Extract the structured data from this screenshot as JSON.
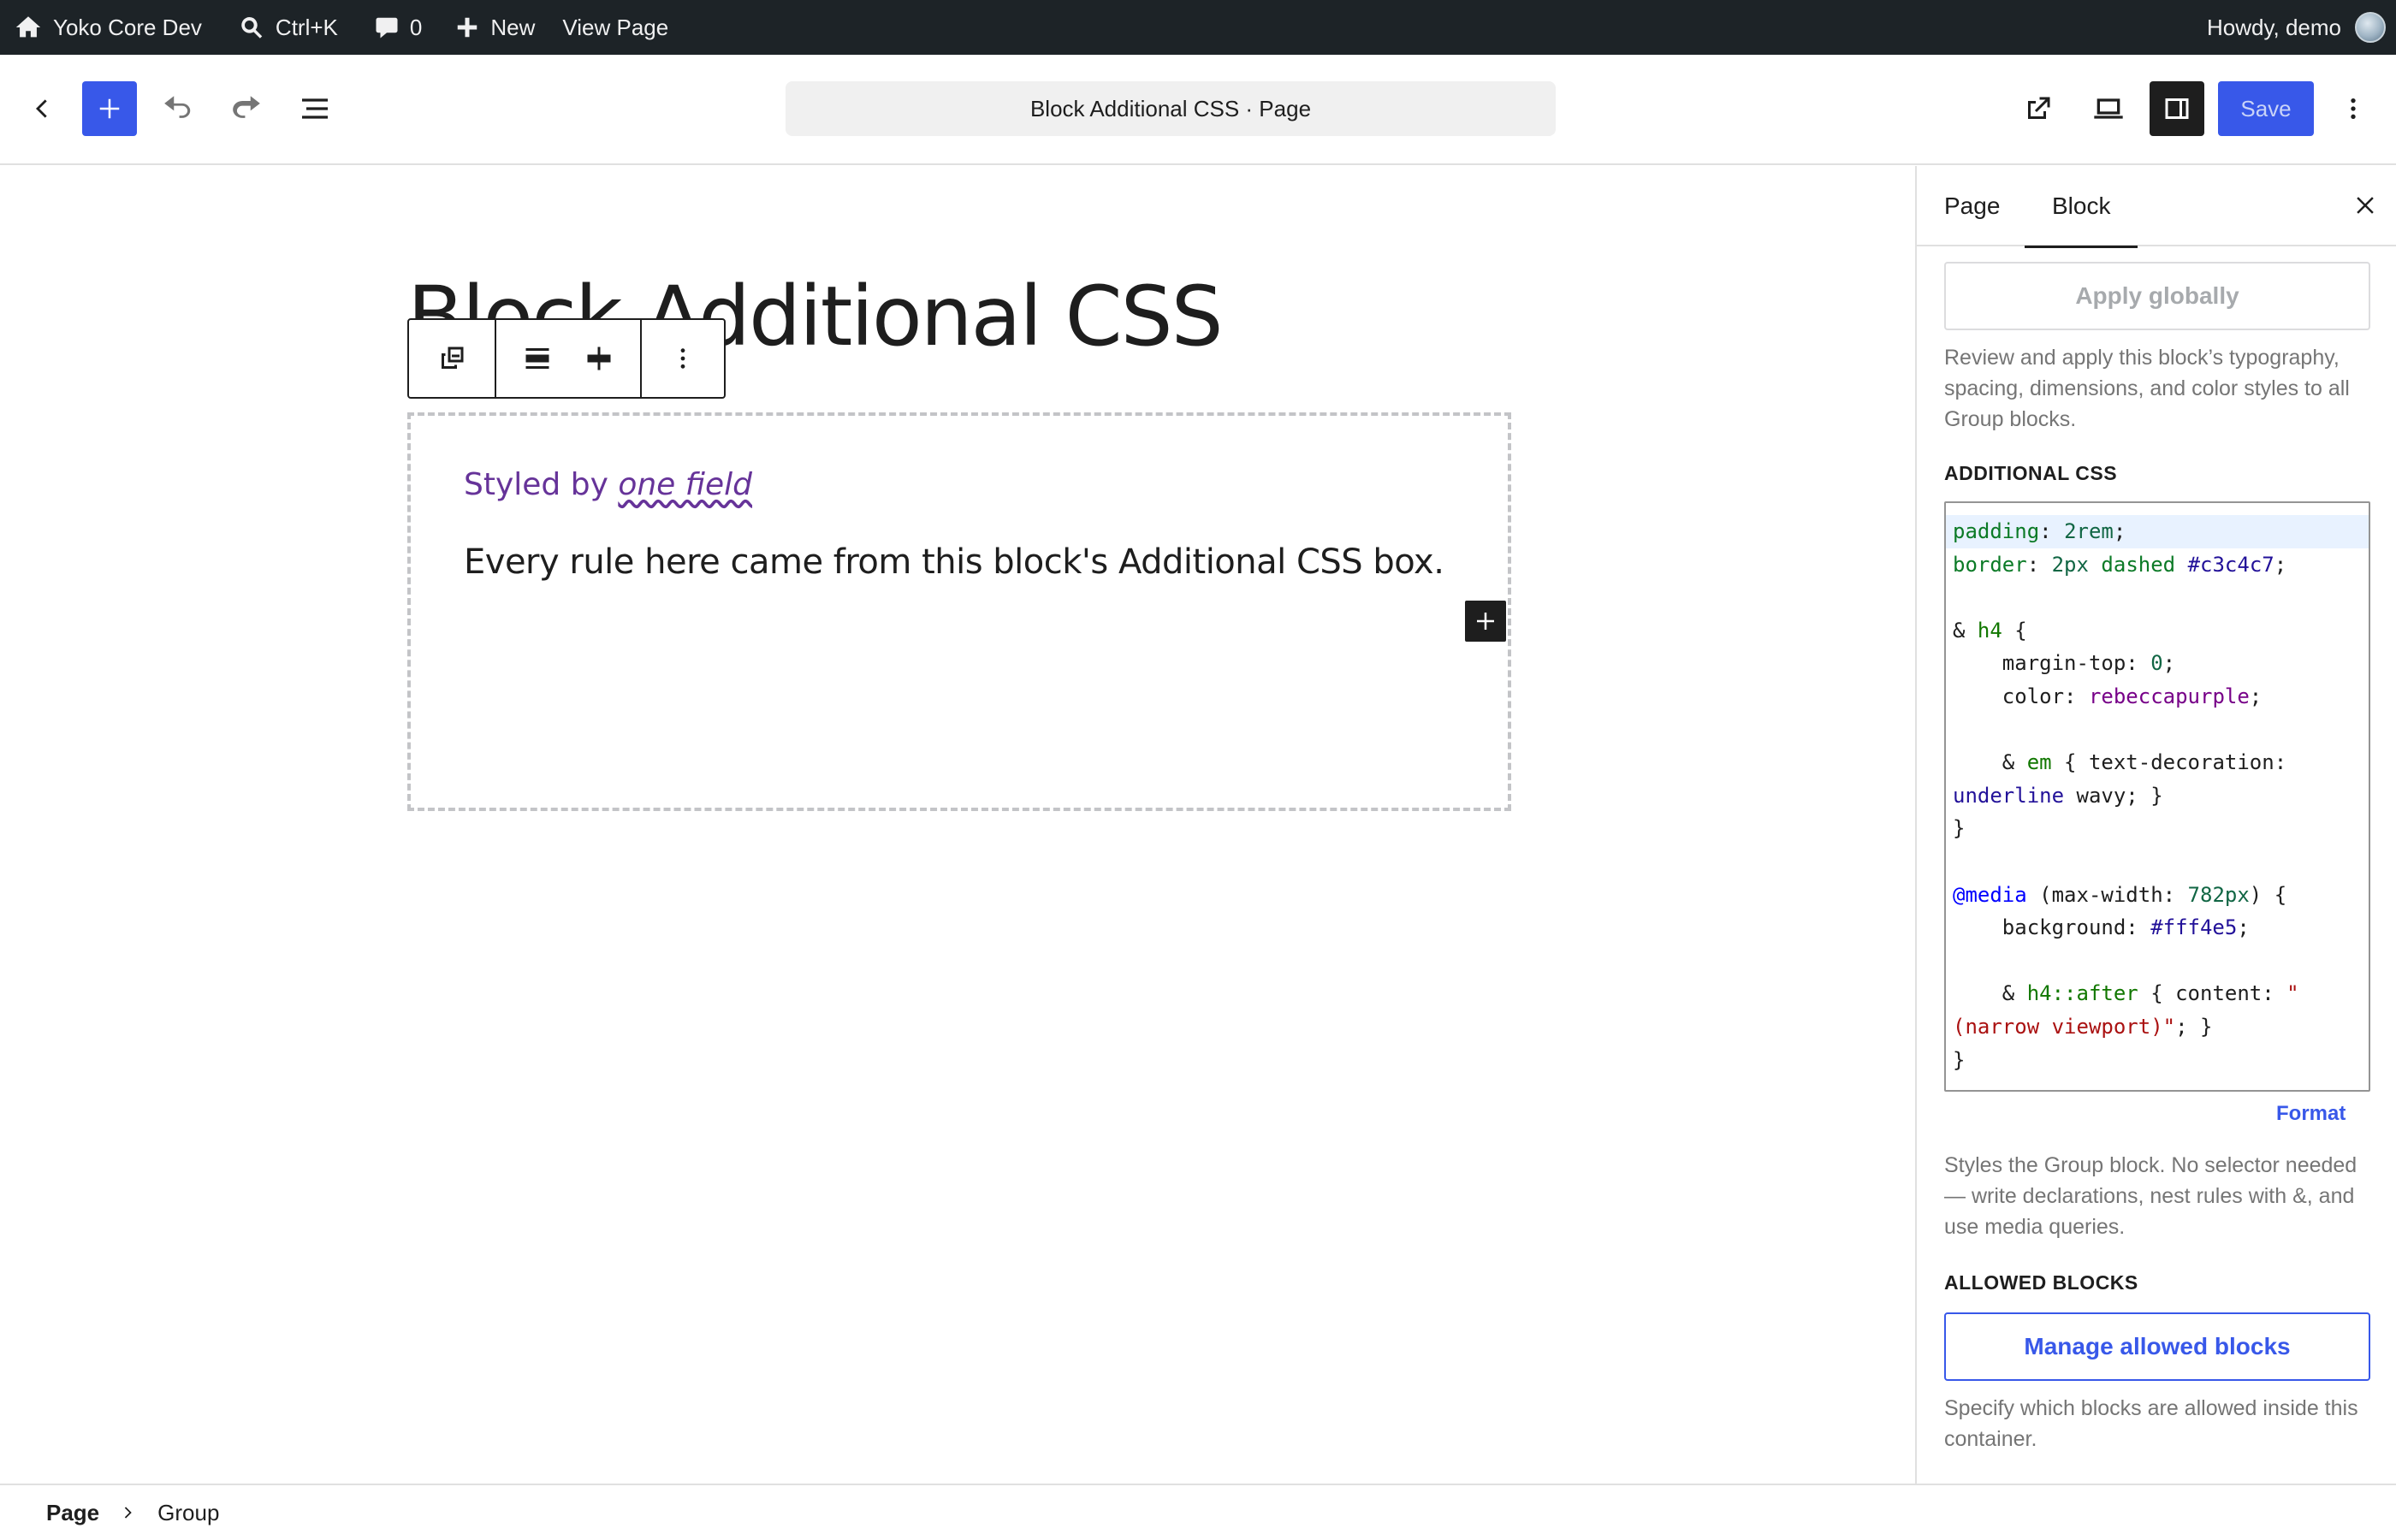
{
  "adminbar": {
    "site_name": "Yoko Core Dev",
    "search_shortcut": "Ctrl+K",
    "comments_count": "0",
    "new_label": "New",
    "view_page_label": "View Page",
    "greeting": "Howdy, demo"
  },
  "header": {
    "document_title": "Block Additional CSS · Page",
    "save_label": "Save"
  },
  "canvas": {
    "page_title": "Block Additional CSS",
    "heading_prefix": "Styled by ",
    "heading_em": "one field",
    "paragraph": "Every rule here came from this block's Additional CSS box."
  },
  "sidebar": {
    "tabs": [
      "Page",
      "Block"
    ],
    "active_tab": "Block",
    "apply_globally_label": "Apply globally",
    "apply_help": "Review and apply this block’s typography, spacing, dimensions, and color styles to all Group blocks.",
    "additional_css_label": "ADDITIONAL CSS",
    "css_code": [
      "padding: 2rem;",
      "border: 2px dashed #c3c4c7;",
      "",
      "& h4 {",
      "    margin-top: 0;",
      "    color: rebeccapurple;",
      "",
      "    & em { text-decoration:",
      "underline wavy; }",
      "}",
      "",
      "@media (max-width: 782px) {",
      "    background: #fff4e5;",
      "",
      "    & h4::after { content: \"",
      "(narrow viewport)\"; }",
      "}"
    ],
    "format_label": "Format",
    "css_help": "Styles the Group block. No selector needed — write declarations, nest rules with &, and use media queries.",
    "allowed_blocks_label": "ALLOWED BLOCKS",
    "manage_allowed_label": "Manage allowed blocks",
    "allowed_help": "Specify which blocks are allowed inside this container."
  },
  "footer": {
    "breadcrumb": [
      "Page",
      "Group"
    ]
  },
  "colors": {
    "accent": "#3858e9",
    "adminbar_bg": "#1d2327",
    "heading_color": "#663399",
    "group_border": "#c3c4c7"
  }
}
